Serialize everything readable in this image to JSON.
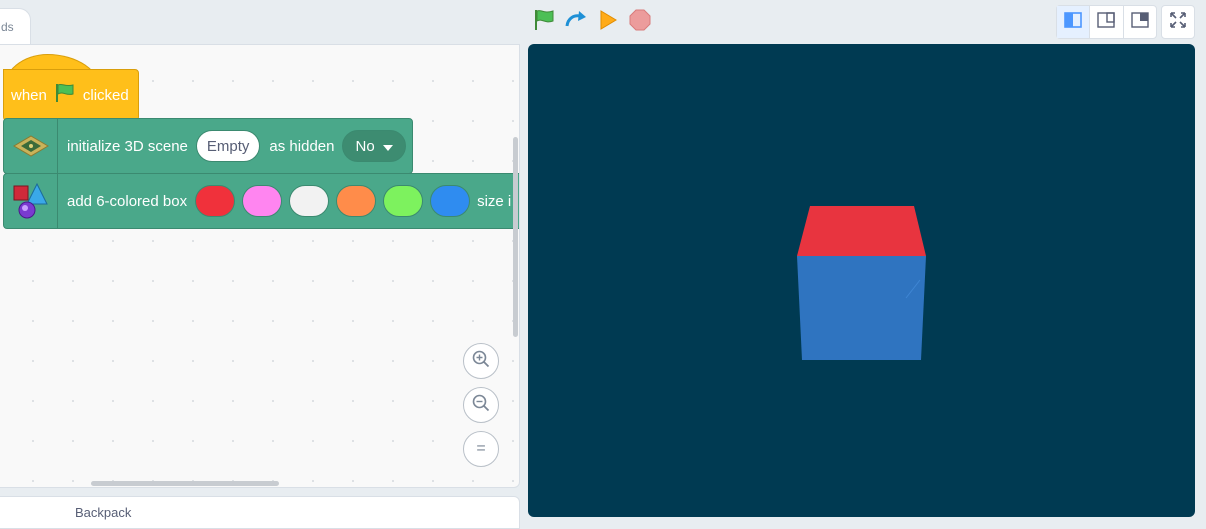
{
  "editor": {
    "tab_label": "ds",
    "backpack_label": "Backpack"
  },
  "blocks": {
    "hat": {
      "when_label": "when",
      "clicked_label": "clicked",
      "color": "#ffbf1a"
    },
    "init_scene": {
      "label": "initialize 3D scene",
      "scene_value": "Empty",
      "hidden_label": "as hidden",
      "hidden_value": "No",
      "color": "#4aa88a"
    },
    "add_box": {
      "label": "add 6-colored box",
      "colors": [
        "#f0313b",
        "#ff85f0",
        "#f2f2f2",
        "#ff8c4a",
        "#7df25e",
        "#2f8cf0"
      ],
      "size_label": "size i"
    }
  },
  "zoom_controls": {
    "zoom_in_symbol": "+",
    "zoom_out_symbol": "−",
    "reset_symbol": "="
  },
  "stage": {
    "background": "#003a52",
    "cube_top_color": "#e8343f",
    "cube_front_color": "#2f74c0"
  },
  "toolbar": {
    "green_flag_icon": "green-flag-icon",
    "turbo_icon": "turbo-arrow-icon",
    "run_icon": "play-triangle-icon",
    "stop_icon": "stop-octagon-icon"
  }
}
